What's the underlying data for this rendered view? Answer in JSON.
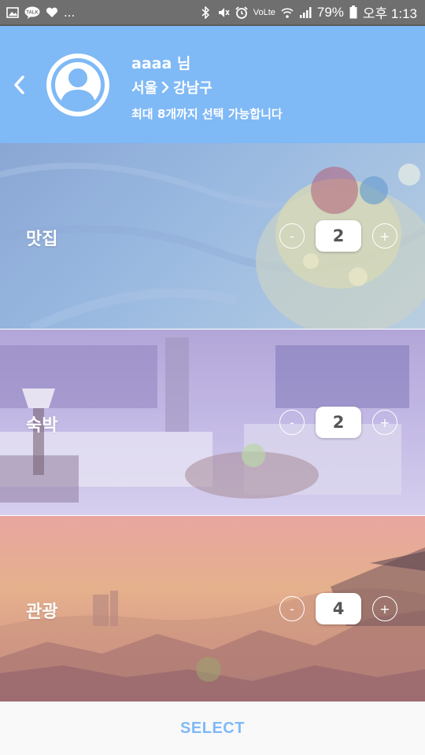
{
  "status_bar": {
    "left_icons": [
      "gallery-icon",
      "kakaotalk-icon",
      "heart-icon"
    ],
    "talk_label": "TALK",
    "more": "...",
    "right_icons": [
      "bluetooth-icon",
      "mute-icon",
      "alarm-icon",
      "volte-icon",
      "wifi-icon",
      "signal-icon",
      "battery-icon"
    ],
    "volte_label": "VoLte",
    "battery_percent": "79%",
    "time": "오후 1:13"
  },
  "header": {
    "user_name": "aaaa 님",
    "region_city": "서울",
    "region_district": "강남구",
    "hint": "최대 8개까지 선택 가능합니다",
    "colors": {
      "background": "#7fb9f6"
    }
  },
  "categories": [
    {
      "label": "맛집",
      "value": "2",
      "minus": "-",
      "plus": "+"
    },
    {
      "label": "숙박",
      "value": "2",
      "minus": "-",
      "plus": "+"
    },
    {
      "label": "관광",
      "value": "4",
      "minus": "-",
      "plus": "+"
    }
  ],
  "footer": {
    "select_label": "SELECT",
    "accent": "#7fb9f6"
  }
}
